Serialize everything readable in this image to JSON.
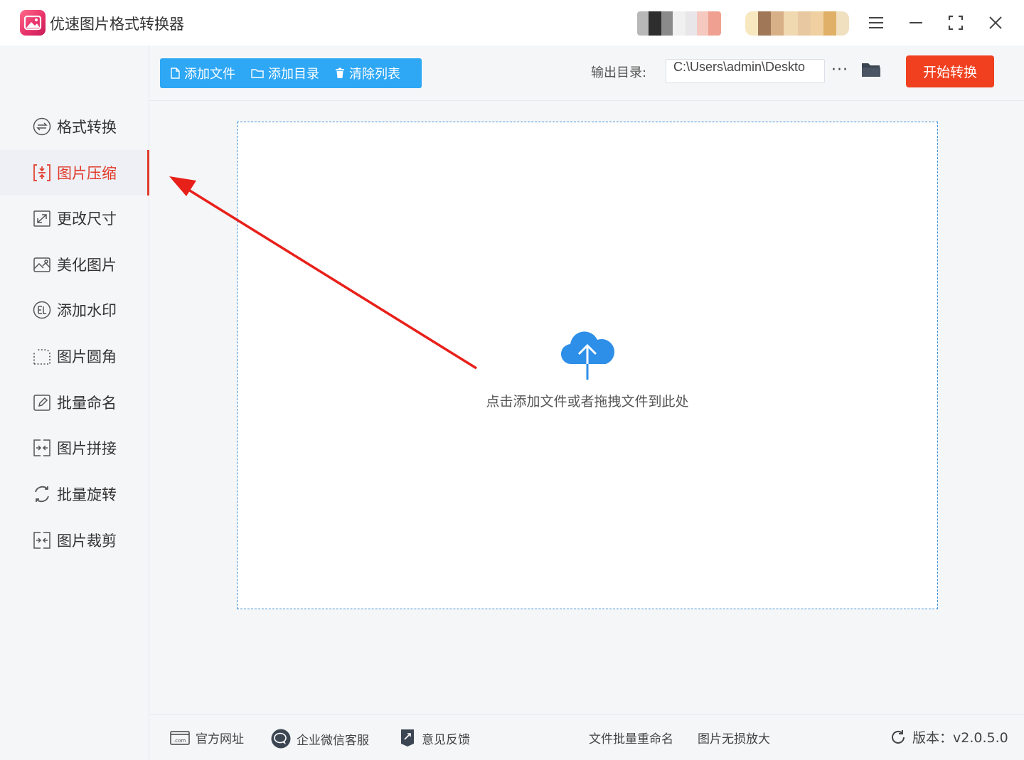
{
  "app": {
    "title": "优速图片格式转换器"
  },
  "toolbar": {
    "add_file": "添加文件",
    "add_folder": "添加目录",
    "clear_list": "清除列表",
    "output_label": "输出目录:",
    "output_path": "C:\\Users\\admin\\Deskto",
    "more": "···",
    "start": "开始转换"
  },
  "sidebar": {
    "items": [
      {
        "label": "格式转换",
        "icon": "format-convert-icon"
      },
      {
        "label": "图片压缩",
        "icon": "compress-icon",
        "active": true
      },
      {
        "label": "更改尺寸",
        "icon": "resize-icon"
      },
      {
        "label": "美化图片",
        "icon": "beautify-icon"
      },
      {
        "label": "添加水印",
        "icon": "watermark-icon"
      },
      {
        "label": "图片圆角",
        "icon": "round-corner-icon"
      },
      {
        "label": "批量命名",
        "icon": "rename-icon"
      },
      {
        "label": "图片拼接",
        "icon": "stitch-icon"
      },
      {
        "label": "批量旋转",
        "icon": "rotate-icon"
      },
      {
        "label": "图片裁剪",
        "icon": "crop-icon"
      }
    ]
  },
  "dropzone": {
    "text": "点击添加文件或者拖拽文件到此处"
  },
  "footer": {
    "website": "官方网址",
    "wechat_service": "企业微信客服",
    "feedback": "意见反馈",
    "batch_rename": "文件批量重命名",
    "lossless_enlarge": "图片无损放大",
    "version": "版本：v2.0.5.0"
  },
  "colors": {
    "accent_blue": "#2ea7f5",
    "start_red": "#f0401f",
    "active_red": "#e03a2a",
    "annotation_arrow": "#e8201a"
  }
}
